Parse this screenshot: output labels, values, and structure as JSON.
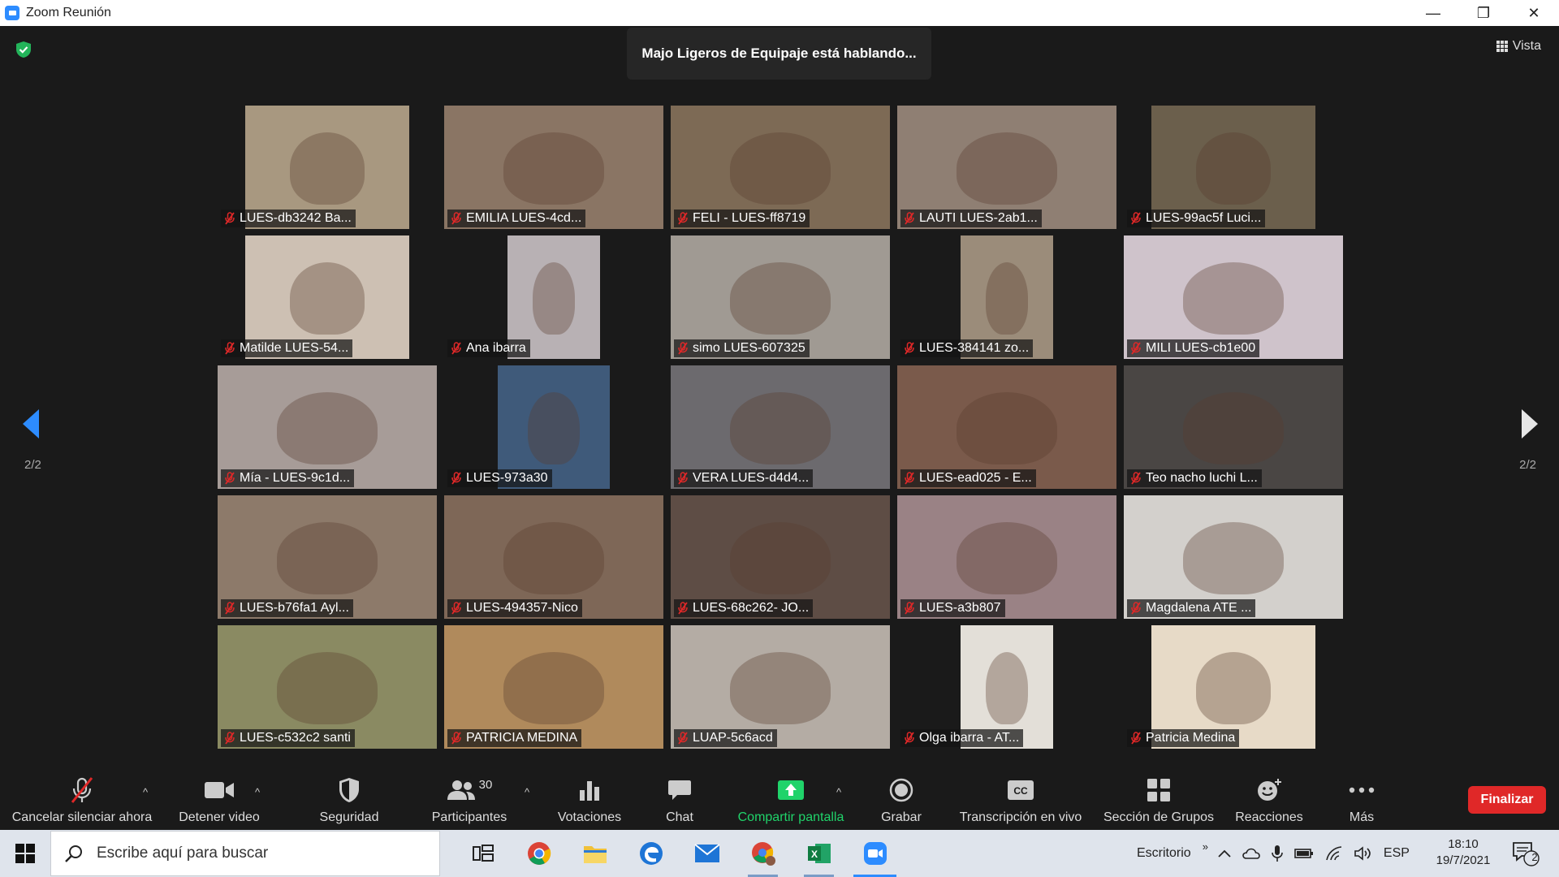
{
  "window": {
    "title": "Zoom Reunión",
    "controls": [
      "—",
      "❐",
      "✕"
    ]
  },
  "meeting": {
    "speaking_banner": "Majo Ligeros de Equipaje está hablando...",
    "view_label": "Vista",
    "page_indicator_left": "2/2",
    "page_indicator_right": "2/2"
  },
  "participants": [
    {
      "name": "LUES-db3242 Ba...",
      "bg": "#a89880",
      "fit": "pillar"
    },
    {
      "name": "EMILIA LUES-4cd...",
      "bg": "#8a7564",
      "fit": "full"
    },
    {
      "name": "FELI - LUES-ff8719",
      "bg": "#7d6a55",
      "fit": "full"
    },
    {
      "name": "LAUTI LUES-2ab1...",
      "bg": "#8f7f73",
      "fit": "full"
    },
    {
      "name": "LUES-99ac5f Luci...",
      "bg": "#6b5f4c",
      "fit": "pillar"
    },
    {
      "name": "Matilde LUES-54...",
      "bg": "#cdc0b3",
      "fit": "pillar"
    },
    {
      "name": "Ana ibarra",
      "bg": "#b8b1b4",
      "fit": "narrow"
    },
    {
      "name": "simo LUES-607325",
      "bg": "#a09a93",
      "fit": "full"
    },
    {
      "name": "LUES-384141 zo...",
      "bg": "#9b8c7a",
      "fit": "narrow"
    },
    {
      "name": "MILI  LUES-cb1e00",
      "bg": "#cfc3cb",
      "fit": "full"
    },
    {
      "name": "Mía - LUES-9c1d...",
      "bg": "#a79c98",
      "fit": "full"
    },
    {
      "name": "LUES-973a30",
      "bg": "#3f5a7a",
      "fit": "mid"
    },
    {
      "name": "VERA LUES-d4d4...",
      "bg": "#6c6a6e",
      "fit": "full"
    },
    {
      "name": "LUES-ead025 - E...",
      "bg": "#7a5a4b",
      "fit": "full"
    },
    {
      "name": "Teo nacho luchi L...",
      "bg": "#4a4644",
      "fit": "full"
    },
    {
      "name": "LUES-b76fa1 Ayl...",
      "bg": "#8d7a6a",
      "fit": "full"
    },
    {
      "name": "LUES-494357-Nico",
      "bg": "#7e6757",
      "fit": "full"
    },
    {
      "name": "LUES-68c262- JO...",
      "bg": "#5e4d45",
      "fit": "full"
    },
    {
      "name": "LUES-a3b807",
      "bg": "#9a8285",
      "fit": "full"
    },
    {
      "name": "Magdalena ATE ...",
      "bg": "#d3d0cc",
      "fit": "full"
    },
    {
      "name": "LUES-c532c2 santi",
      "bg": "#8a8a62",
      "fit": "full"
    },
    {
      "name": "PATRICIA MEDINA",
      "bg": "#b08a5c",
      "fit": "full"
    },
    {
      "name": "LUAP-5c6acd",
      "bg": "#b4aca4",
      "fit": "full"
    },
    {
      "name": "Olga ibarra -  AT...",
      "bg": "#e3dfd8",
      "fit": "narrow"
    },
    {
      "name": "Patricia Medina",
      "bg": "#e7dac7",
      "fit": "pillar"
    }
  ],
  "toolbar": {
    "unmute_label": "Cancelar silenciar ahora",
    "video_label": "Detener video",
    "security_label": "Seguridad",
    "participants_label": "Participantes",
    "participants_count": "30",
    "polls_label": "Votaciones",
    "chat_label": "Chat",
    "share_label": "Compartir pantalla",
    "record_label": "Grabar",
    "transcription_label": "Transcripción en vivo",
    "breakout_label": "Sección de Grupos",
    "reactions_label": "Reacciones",
    "more_label": "Más",
    "end_label": "Finalizar"
  },
  "colors": {
    "share_green": "#20d36a",
    "end_red": "#e02828",
    "zoom_blue": "#2d8cff"
  },
  "taskbar": {
    "search_placeholder": "Escribe aquí para buscar",
    "desktop_label": "Escritorio",
    "tray_chevron": "»",
    "language": "ESP",
    "time": "18:10",
    "date": "19/7/2021",
    "notification_count": "2"
  }
}
